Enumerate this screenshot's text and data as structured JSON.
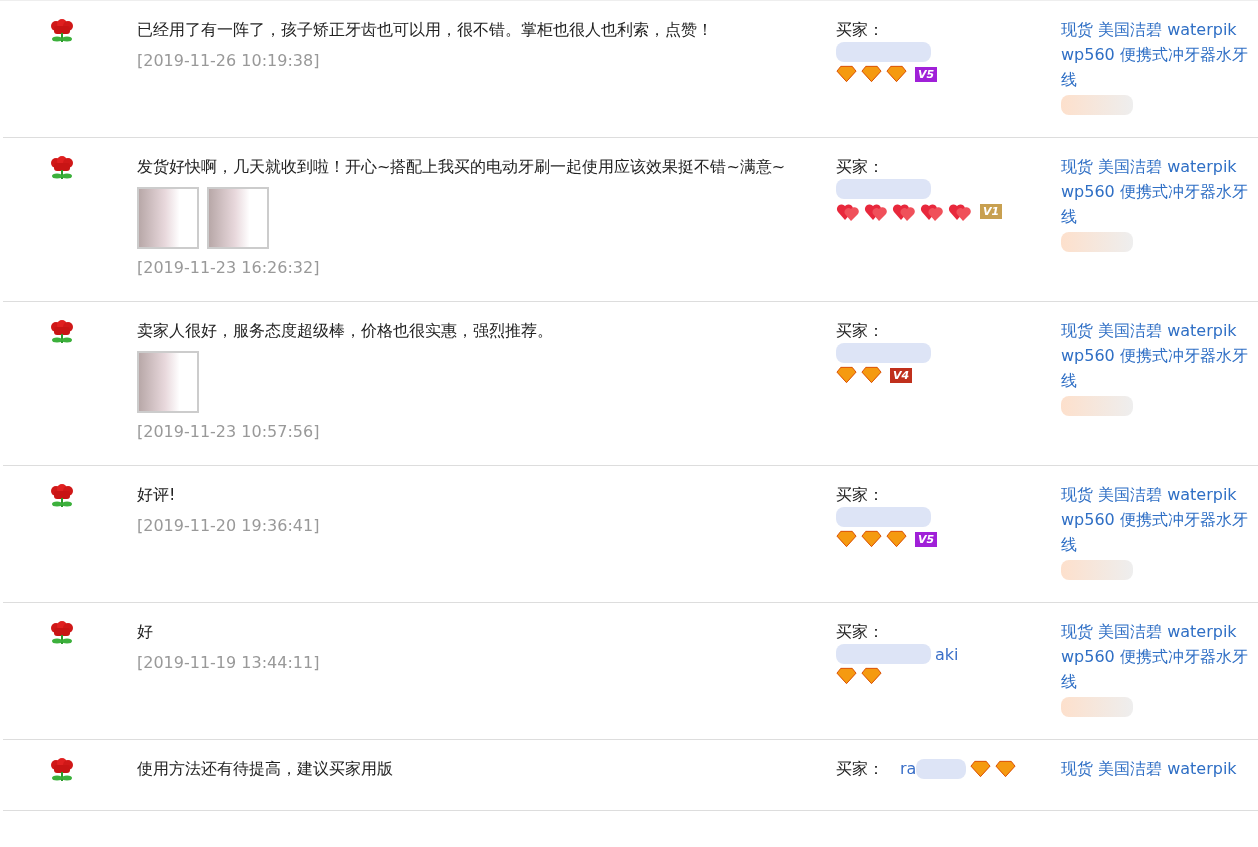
{
  "reviews": [
    {
      "comment": "已经用了有一阵了，孩子矫正牙齿也可以用，很不错。掌柜也很人也利索，点赞！",
      "date": "[2019-11-26 10:19:38]",
      "buyer_label": "买家：",
      "rating_icons": [
        {
          "kind": "diamond"
        },
        {
          "kind": "diamond"
        },
        {
          "kind": "diamond"
        }
      ],
      "vip": {
        "label": "V5",
        "color": "#a020d8"
      },
      "product": "现货 美国洁碧 waterpik wp560 便携式冲牙器水牙线"
    },
    {
      "comment": "发货好快啊，几天就收到啦！开心~搭配上我买的电动牙刷一起使用应该效果挺不错~满意~",
      "photos": [
        {
          "kind": "photo"
        },
        {
          "kind": "photo"
        }
      ],
      "date": "[2019-11-23 16:26:32]",
      "buyer_label": "买家：",
      "rating_icons": [
        {
          "kind": "heart"
        },
        {
          "kind": "heart"
        },
        {
          "kind": "heart"
        },
        {
          "kind": "heart"
        },
        {
          "kind": "heart"
        }
      ],
      "vip": {
        "label": "V1",
        "color": "#c8a050"
      },
      "product": "现货 美国洁碧 waterpik wp560 便携式冲牙器水牙线"
    },
    {
      "comment": "卖家人很好，服务态度超级棒，价格也很实惠，强烈推荐。",
      "photos": [
        {
          "kind": "photo"
        }
      ],
      "date": "[2019-11-23 10:57:56]",
      "buyer_label": "买家：",
      "rating_icons": [
        {
          "kind": "diamond"
        },
        {
          "kind": "diamond"
        }
      ],
      "vip": {
        "label": "V4",
        "color": "#c0301c"
      },
      "product": "现货 美国洁碧 waterpik wp560 便携式冲牙器水牙线"
    },
    {
      "comment": "好评!",
      "date": "[2019-11-20 19:36:41]",
      "buyer_label": "买家：",
      "rating_icons": [
        {
          "kind": "diamond"
        },
        {
          "kind": "diamond"
        },
        {
          "kind": "diamond"
        }
      ],
      "vip": {
        "label": "V5",
        "color": "#a020d8"
      },
      "product": "现货 美国洁碧 waterpik wp560 便携式冲牙器水牙线"
    },
    {
      "comment": "好",
      "date": "[2019-11-19 13:44:11]",
      "buyer_label": "买家：",
      "buyer_name": "aki",
      "rating_icons": [
        {
          "kind": "diamond"
        },
        {
          "kind": "diamond"
        }
      ],
      "product": "现货 美国洁碧 waterpik wp560 便携式冲牙器水牙线"
    },
    {
      "comment": "使用方法还有待提高，建议买家用版",
      "buyer_label": "买家：",
      "buyer_name": "ra",
      "rating_icons": [
        {
          "kind": "diamond"
        },
        {
          "kind": "diamond"
        }
      ],
      "product": "现货 美国洁碧 waterpik"
    }
  ]
}
